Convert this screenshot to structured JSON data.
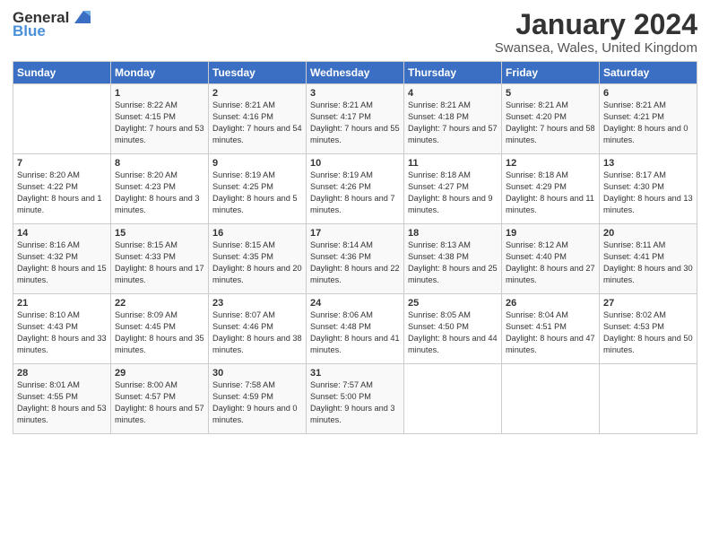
{
  "header": {
    "logo_general": "General",
    "logo_blue": "Blue",
    "month": "January 2024",
    "location": "Swansea, Wales, United Kingdom"
  },
  "weekdays": [
    "Sunday",
    "Monday",
    "Tuesday",
    "Wednesday",
    "Thursday",
    "Friday",
    "Saturday"
  ],
  "weeks": [
    [
      {
        "day": "",
        "sunrise": "",
        "sunset": "",
        "daylight": ""
      },
      {
        "day": "1",
        "sunrise": "Sunrise: 8:22 AM",
        "sunset": "Sunset: 4:15 PM",
        "daylight": "Daylight: 7 hours and 53 minutes."
      },
      {
        "day": "2",
        "sunrise": "Sunrise: 8:21 AM",
        "sunset": "Sunset: 4:16 PM",
        "daylight": "Daylight: 7 hours and 54 minutes."
      },
      {
        "day": "3",
        "sunrise": "Sunrise: 8:21 AM",
        "sunset": "Sunset: 4:17 PM",
        "daylight": "Daylight: 7 hours and 55 minutes."
      },
      {
        "day": "4",
        "sunrise": "Sunrise: 8:21 AM",
        "sunset": "Sunset: 4:18 PM",
        "daylight": "Daylight: 7 hours and 57 minutes."
      },
      {
        "day": "5",
        "sunrise": "Sunrise: 8:21 AM",
        "sunset": "Sunset: 4:20 PM",
        "daylight": "Daylight: 7 hours and 58 minutes."
      },
      {
        "day": "6",
        "sunrise": "Sunrise: 8:21 AM",
        "sunset": "Sunset: 4:21 PM",
        "daylight": "Daylight: 8 hours and 0 minutes."
      }
    ],
    [
      {
        "day": "7",
        "sunrise": "Sunrise: 8:20 AM",
        "sunset": "Sunset: 4:22 PM",
        "daylight": "Daylight: 8 hours and 1 minute."
      },
      {
        "day": "8",
        "sunrise": "Sunrise: 8:20 AM",
        "sunset": "Sunset: 4:23 PM",
        "daylight": "Daylight: 8 hours and 3 minutes."
      },
      {
        "day": "9",
        "sunrise": "Sunrise: 8:19 AM",
        "sunset": "Sunset: 4:25 PM",
        "daylight": "Daylight: 8 hours and 5 minutes."
      },
      {
        "day": "10",
        "sunrise": "Sunrise: 8:19 AM",
        "sunset": "Sunset: 4:26 PM",
        "daylight": "Daylight: 8 hours and 7 minutes."
      },
      {
        "day": "11",
        "sunrise": "Sunrise: 8:18 AM",
        "sunset": "Sunset: 4:27 PM",
        "daylight": "Daylight: 8 hours and 9 minutes."
      },
      {
        "day": "12",
        "sunrise": "Sunrise: 8:18 AM",
        "sunset": "Sunset: 4:29 PM",
        "daylight": "Daylight: 8 hours and 11 minutes."
      },
      {
        "day": "13",
        "sunrise": "Sunrise: 8:17 AM",
        "sunset": "Sunset: 4:30 PM",
        "daylight": "Daylight: 8 hours and 13 minutes."
      }
    ],
    [
      {
        "day": "14",
        "sunrise": "Sunrise: 8:16 AM",
        "sunset": "Sunset: 4:32 PM",
        "daylight": "Daylight: 8 hours and 15 minutes."
      },
      {
        "day": "15",
        "sunrise": "Sunrise: 8:15 AM",
        "sunset": "Sunset: 4:33 PM",
        "daylight": "Daylight: 8 hours and 17 minutes."
      },
      {
        "day": "16",
        "sunrise": "Sunrise: 8:15 AM",
        "sunset": "Sunset: 4:35 PM",
        "daylight": "Daylight: 8 hours and 20 minutes."
      },
      {
        "day": "17",
        "sunrise": "Sunrise: 8:14 AM",
        "sunset": "Sunset: 4:36 PM",
        "daylight": "Daylight: 8 hours and 22 minutes."
      },
      {
        "day": "18",
        "sunrise": "Sunrise: 8:13 AM",
        "sunset": "Sunset: 4:38 PM",
        "daylight": "Daylight: 8 hours and 25 minutes."
      },
      {
        "day": "19",
        "sunrise": "Sunrise: 8:12 AM",
        "sunset": "Sunset: 4:40 PM",
        "daylight": "Daylight: 8 hours and 27 minutes."
      },
      {
        "day": "20",
        "sunrise": "Sunrise: 8:11 AM",
        "sunset": "Sunset: 4:41 PM",
        "daylight": "Daylight: 8 hours and 30 minutes."
      }
    ],
    [
      {
        "day": "21",
        "sunrise": "Sunrise: 8:10 AM",
        "sunset": "Sunset: 4:43 PM",
        "daylight": "Daylight: 8 hours and 33 minutes."
      },
      {
        "day": "22",
        "sunrise": "Sunrise: 8:09 AM",
        "sunset": "Sunset: 4:45 PM",
        "daylight": "Daylight: 8 hours and 35 minutes."
      },
      {
        "day": "23",
        "sunrise": "Sunrise: 8:07 AM",
        "sunset": "Sunset: 4:46 PM",
        "daylight": "Daylight: 8 hours and 38 minutes."
      },
      {
        "day": "24",
        "sunrise": "Sunrise: 8:06 AM",
        "sunset": "Sunset: 4:48 PM",
        "daylight": "Daylight: 8 hours and 41 minutes."
      },
      {
        "day": "25",
        "sunrise": "Sunrise: 8:05 AM",
        "sunset": "Sunset: 4:50 PM",
        "daylight": "Daylight: 8 hours and 44 minutes."
      },
      {
        "day": "26",
        "sunrise": "Sunrise: 8:04 AM",
        "sunset": "Sunset: 4:51 PM",
        "daylight": "Daylight: 8 hours and 47 minutes."
      },
      {
        "day": "27",
        "sunrise": "Sunrise: 8:02 AM",
        "sunset": "Sunset: 4:53 PM",
        "daylight": "Daylight: 8 hours and 50 minutes."
      }
    ],
    [
      {
        "day": "28",
        "sunrise": "Sunrise: 8:01 AM",
        "sunset": "Sunset: 4:55 PM",
        "daylight": "Daylight: 8 hours and 53 minutes."
      },
      {
        "day": "29",
        "sunrise": "Sunrise: 8:00 AM",
        "sunset": "Sunset: 4:57 PM",
        "daylight": "Daylight: 8 hours and 57 minutes."
      },
      {
        "day": "30",
        "sunrise": "Sunrise: 7:58 AM",
        "sunset": "Sunset: 4:59 PM",
        "daylight": "Daylight: 9 hours and 0 minutes."
      },
      {
        "day": "31",
        "sunrise": "Sunrise: 7:57 AM",
        "sunset": "Sunset: 5:00 PM",
        "daylight": "Daylight: 9 hours and 3 minutes."
      },
      {
        "day": "",
        "sunrise": "",
        "sunset": "",
        "daylight": ""
      },
      {
        "day": "",
        "sunrise": "",
        "sunset": "",
        "daylight": ""
      },
      {
        "day": "",
        "sunrise": "",
        "sunset": "",
        "daylight": ""
      }
    ]
  ]
}
